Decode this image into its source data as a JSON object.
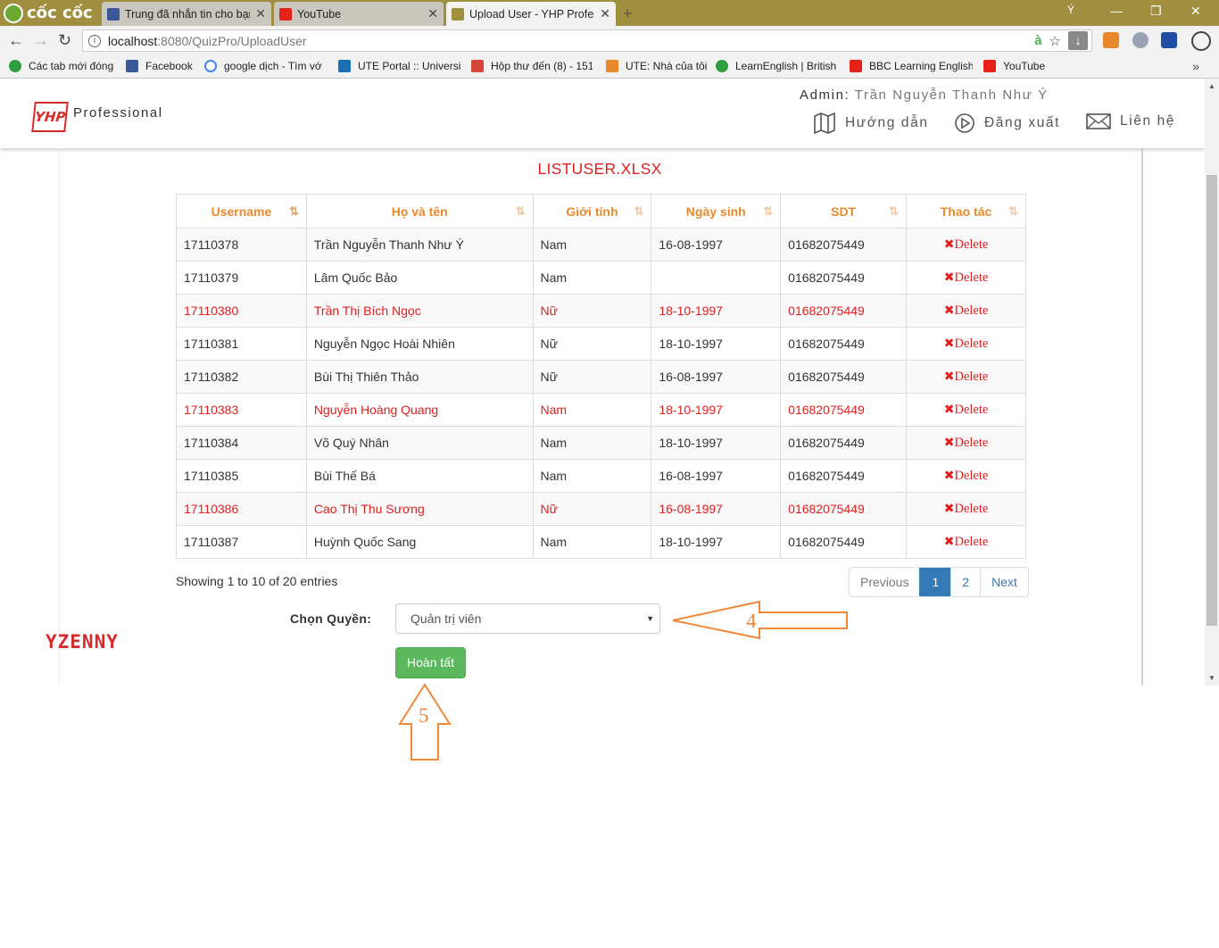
{
  "browser": {
    "brand": "cốc cốc",
    "tabs": [
      {
        "title": "Trung đã nhắn tin cho bạn",
        "icon_color": "#3b5998"
      },
      {
        "title": "YouTube",
        "icon_color": "#e62117"
      },
      {
        "title": "Upload User - YHP Profess",
        "icon_color": "#a08f3e"
      }
    ],
    "profile_initial": "Ý",
    "url_host": "localhost",
    "url_path": ":8080/QuizPro/UploadUser",
    "bookmarks": [
      {
        "label": "Các tab mới đóng",
        "icon_color": "#2e9e3e"
      },
      {
        "label": "Facebook",
        "icon_color": "#3b5998"
      },
      {
        "label": "google dịch - Tìm vớ",
        "icon_color": "#4285f4"
      },
      {
        "label": "UTE Portal :: Universit",
        "icon_color": "#1a6fb5"
      },
      {
        "label": "Hộp thư đến (8) - 151",
        "icon_color": "#d44638"
      },
      {
        "label": "UTE: Nhà của tôi",
        "icon_color": "#e8892b"
      },
      {
        "label": "LearnEnglish | British",
        "icon_color": "#2e9e3e"
      },
      {
        "label": "BBC Learning English",
        "icon_color": "#e62117"
      },
      {
        "label": "YouTube",
        "icon_color": "#e62117"
      }
    ]
  },
  "header": {
    "logo": "YHP",
    "logo_text": "Professional",
    "admin_label": "Admin:",
    "admin_name": "Trần Nguyễn Thanh Như Ý",
    "nav": {
      "guide": "Hướng dẫn",
      "logout": "Đăng xuất",
      "contact": "Liên hệ"
    }
  },
  "file_title": "LISTUSER.XLSX",
  "table": {
    "headers": [
      "Username",
      "Họ và tên",
      "Giới tính",
      "Ngày sinh",
      "SDT",
      "Thao tác"
    ],
    "delete_label": "Delete",
    "rows": [
      {
        "username": "17110378",
        "name": "Trần Nguyễn Thanh Như Ý",
        "gender": "Nam",
        "dob": "16-08-1997",
        "phone": "01682075449",
        "highlight": false
      },
      {
        "username": "17110379",
        "name": "Lâm Quốc Bảo",
        "gender": "Nam",
        "dob": "",
        "phone": "01682075449",
        "highlight": false
      },
      {
        "username": "17110380",
        "name": "Trần Thị Bích Ngọc",
        "gender": "Nữ",
        "dob": "18-10-1997",
        "phone": "01682075449",
        "highlight": true
      },
      {
        "username": "17110381",
        "name": "Nguyễn Ngọc Hoài Nhiên",
        "gender": "Nữ",
        "dob": "18-10-1997",
        "phone": "01682075449",
        "highlight": false
      },
      {
        "username": "17110382",
        "name": "Bùi Thị Thiên Thảo",
        "gender": "Nữ",
        "dob": "16-08-1997",
        "phone": "01682075449",
        "highlight": false
      },
      {
        "username": "17110383",
        "name": "Nguyễn Hoàng Quang",
        "gender": "Nam",
        "dob": "18-10-1997",
        "phone": "01682075449",
        "highlight": true
      },
      {
        "username": "17110384",
        "name": "Võ Quý Nhân",
        "gender": "Nam",
        "dob": "18-10-1997",
        "phone": "01682075449",
        "highlight": false
      },
      {
        "username": "17110385",
        "name": "Bùi Thế Bá",
        "gender": "Nam",
        "dob": "16-08-1997",
        "phone": "01682075449",
        "highlight": false
      },
      {
        "username": "17110386",
        "name": "Cao Thị Thu Sương",
        "gender": "Nữ",
        "dob": "16-08-1997",
        "phone": "01682075449",
        "highlight": true
      },
      {
        "username": "17110387",
        "name": "Huỳnh Quốc Sang",
        "gender": "Nam",
        "dob": "18-10-1997",
        "phone": "01682075449",
        "highlight": false
      }
    ]
  },
  "pagination": {
    "showing": "Showing 1 to 10 of 20 entries",
    "previous": "Previous",
    "pages": [
      "1",
      "2"
    ],
    "current": "1",
    "next": "Next"
  },
  "role": {
    "label": "Chọn Quyền:",
    "selected": "Quản trị viên"
  },
  "done_button": "Hoàn tất",
  "watermark": "YZENNY",
  "annotations": {
    "arrow_select": "4",
    "arrow_button": "5",
    "color": "#f0883a"
  },
  "colors": {
    "accent_orange": "#e8892b",
    "highlight_red": "#e21e1e",
    "primary_blue": "#337ab7",
    "success_green": "#5cb85c"
  }
}
